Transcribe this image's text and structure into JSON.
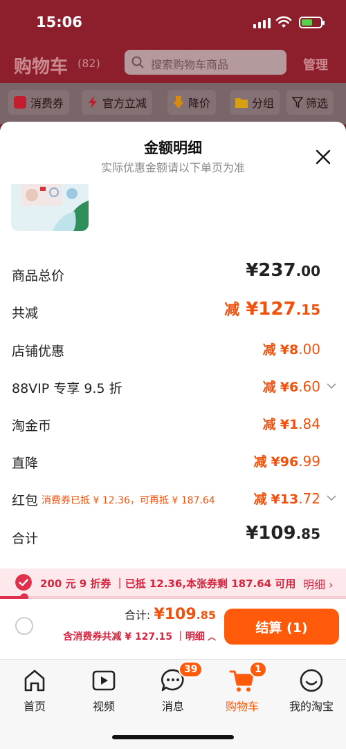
{
  "status": {
    "time": "15:06"
  },
  "header": {
    "title": "购物车",
    "count": "(82)",
    "search_placeholder": "搜索购物车商品",
    "manage": "管理"
  },
  "filters": [
    {
      "label": "消费券",
      "icon": "coupon-icon",
      "color": "#c11d2e"
    },
    {
      "label": "官方立减",
      "icon": "lightning-icon",
      "color": "#c11d2e"
    },
    {
      "label": "降价",
      "icon": "price-drop-icon",
      "color": "#d88a10"
    },
    {
      "label": "分组",
      "icon": "folder-icon",
      "color": "#d8a010"
    },
    {
      "label": "筛选",
      "icon": "filter-icon",
      "color": "#2a1315"
    }
  ],
  "sheet": {
    "title": "金额明细",
    "subtitle": "实际优惠金额请以下单页为准",
    "rows": {
      "total_price": {
        "label": "商品总价",
        "value_int": "¥237",
        "value_dec": ".00"
      },
      "total_reduce": {
        "label": "共减",
        "prefix": "减",
        "value_int": "¥127",
        "value_dec": ".15"
      },
      "shop": {
        "label": "店铺优惠",
        "prefix": "减",
        "value_int": "¥8",
        "value_dec": ".00"
      },
      "vip": {
        "label": "88VIP 专享 9.5 折",
        "prefix": "减",
        "value_int": "¥6",
        "value_dec": ".60"
      },
      "coin": {
        "label": "淘金币",
        "prefix": "减",
        "value_int": "¥1",
        "value_dec": ".84"
      },
      "direct": {
        "label": "直降",
        "prefix": "减",
        "value_int": "¥96",
        "value_dec": ".99"
      },
      "hongbao": {
        "label": "红包",
        "note": "消费券已抵 ¥ 12.36，可再抵 ¥ 187.64",
        "prefix": "减",
        "value_int": "¥13",
        "value_dec": ".72"
      },
      "sum": {
        "label": "合计",
        "value_int": "¥109",
        "value_dec": ".85"
      }
    }
  },
  "coupon_bar": {
    "text": "200 元 9 折券 ｜已抵 12.36,本张券剩 187.64 可用",
    "detail": "明细",
    "progress": 0.07
  },
  "checkout": {
    "total_label": "合计:",
    "total_int": "¥109",
    "total_dec": ".85",
    "reduce_text": "含消费券共减 ¥ 127.15",
    "detail": "明细",
    "pay": "结算 (1)"
  },
  "tabs": [
    {
      "label": "首页",
      "icon": "home-icon"
    },
    {
      "label": "视频",
      "icon": "video-icon"
    },
    {
      "label": "消息",
      "icon": "message-icon",
      "badge": "39"
    },
    {
      "label": "购物车",
      "icon": "cart-icon",
      "badge": "1",
      "active": true
    },
    {
      "label": "我的淘宝",
      "icon": "profile-icon"
    }
  ],
  "colors": {
    "accent": "#ff5a0a",
    "price": "#f0520d",
    "coupon": "#d6253f",
    "header_bg": "#8d1f2c"
  }
}
